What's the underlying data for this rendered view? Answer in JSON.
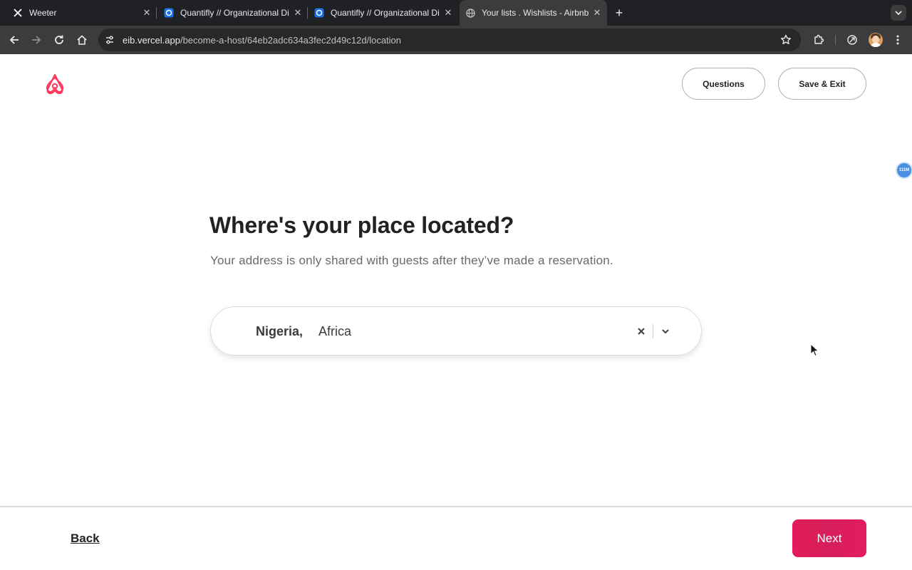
{
  "browser": {
    "tabs": [
      {
        "title": "Weeter",
        "icon": "x-logo-icon",
        "active": false
      },
      {
        "title": "Quantifly // Organizational Dia",
        "icon": "quantifly-favicon-icon",
        "active": false
      },
      {
        "title": "Quantifly // Organizational Dia",
        "icon": "quantifly-favicon-icon",
        "active": false
      },
      {
        "title": "Your lists . Wishlists - Airbnb",
        "icon": "globe-icon",
        "active": true
      }
    ],
    "url_host": "eib.vercel.app",
    "url_path": "/become-a-host/64eb2adc634a3fec2d49c12d/location"
  },
  "header": {
    "questions_label": "Questions",
    "save_exit_label": "Save & Exit",
    "extension_badge": "111M"
  },
  "main": {
    "heading": "Where's your place located?",
    "subtext": "Your address is only shared with guests after they’ve made a reservation.",
    "location": {
      "country": "Nigeria,",
      "region": "Africa"
    }
  },
  "footer": {
    "back_label": "Back",
    "next_label": "Next"
  },
  "colors": {
    "brand": "#ff385c",
    "next_button": "#e01d5a",
    "chrome_dark": "#202124",
    "chrome_toolbar": "#3c3c3c"
  }
}
